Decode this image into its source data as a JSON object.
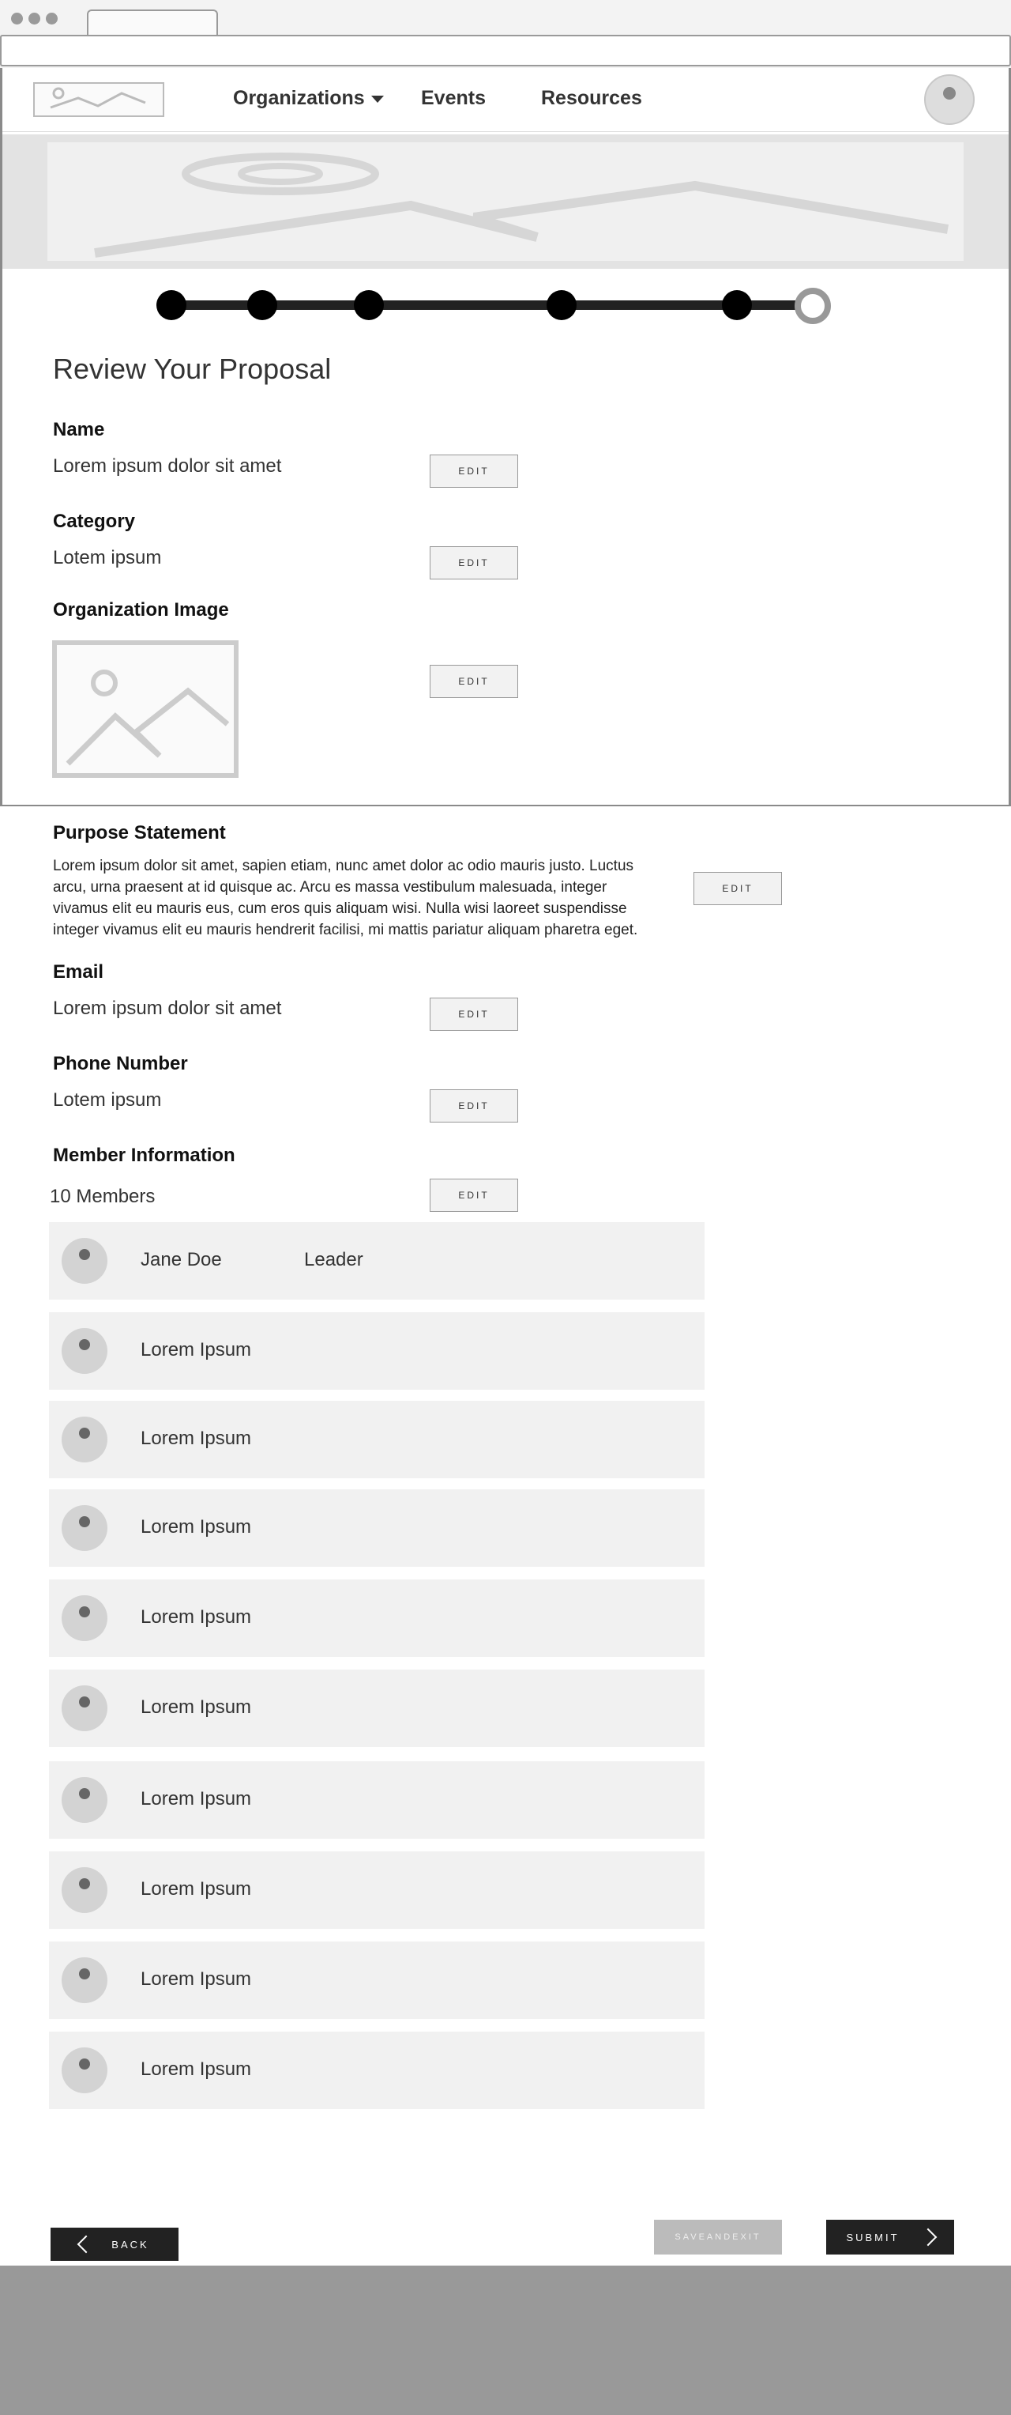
{
  "nav": {
    "links": [
      "Organizations",
      "Events",
      "Resources"
    ]
  },
  "progress": {
    "steps_total": 6,
    "current_step": 6
  },
  "page_title": "Review Your Proposal",
  "sections": {
    "name": {
      "label": "Name",
      "value": "Lorem ipsum dolor sit amet",
      "edit": "EDIT"
    },
    "category": {
      "label": "Category",
      "value": "Lotem ipsum",
      "edit": "EDIT"
    },
    "org_image": {
      "label": "Organization Image",
      "edit": "EDIT"
    },
    "purpose": {
      "label": "Purpose Statement",
      "lines": [
        "Lorem ipsum dolor sit amet, sapien etiam, nunc amet dolor ac odio mauris justo. Luctus",
        "arcu, urna praesent at id quisque ac. Arcu es massa vestibulum malesuada, integer",
        "vivamus elit eu mauris eus, cum eros quis aliquam wisi. Nulla wisi laoreet suspendisse",
        "integer vivamus elit eu mauris hendrerit facilisi, mi mattis pariatur aliquam pharetra eget."
      ],
      "edit": "EDIT"
    },
    "email": {
      "label": "Email",
      "value": "Lorem ipsum dolor sit amet",
      "edit": "EDIT"
    },
    "phone": {
      "label": "Phone Number",
      "value": "Lotem ipsum",
      "edit": "EDIT"
    },
    "members": {
      "label": "Member Information",
      "count": "10 Members",
      "edit": "EDIT"
    }
  },
  "members": [
    {
      "name": "Jane Doe",
      "role": "Leader"
    },
    {
      "name": "Lorem Ipsum",
      "role": ""
    },
    {
      "name": "Lorem Ipsum",
      "role": ""
    },
    {
      "name": "Lorem Ipsum",
      "role": ""
    },
    {
      "name": "Lorem Ipsum",
      "role": ""
    },
    {
      "name": "Lorem Ipsum",
      "role": ""
    },
    {
      "name": "Lorem Ipsum",
      "role": ""
    },
    {
      "name": "Lorem Ipsum",
      "role": ""
    },
    {
      "name": "Lorem Ipsum",
      "role": ""
    },
    {
      "name": "Lorem Ipsum",
      "role": ""
    }
  ],
  "buttons": {
    "back": "BACK",
    "save": "SAVEANDEXIT",
    "submit": "SUBMIT"
  },
  "icons": {
    "logo": "image-placeholder-icon",
    "dropdown": "caret-down-icon",
    "avatar": "user-avatar-icon",
    "back": "chevron-left-icon",
    "submit": "chevron-right-icon"
  },
  "colors": {
    "dark_button": "#222222",
    "disabled_button": "#bbbbbb",
    "footer": "#999999"
  }
}
